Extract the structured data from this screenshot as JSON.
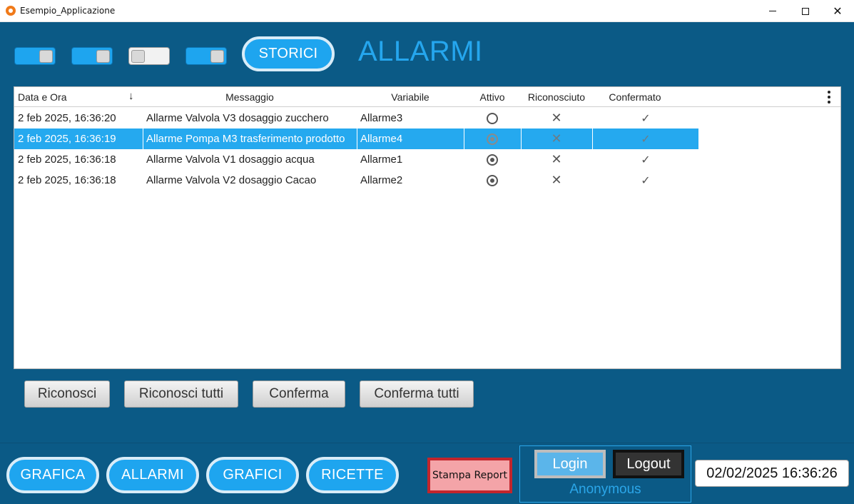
{
  "window": {
    "title": "Esempio_Applicazione",
    "minimize": "",
    "maximize": "",
    "close": "✕"
  },
  "header": {
    "storici_button": "STORICI",
    "heading": "ALLARMI",
    "toggles": [
      "on",
      "on",
      "off",
      "on"
    ]
  },
  "table": {
    "columns": [
      "Data e Ora",
      "Messaggio",
      "Variabile",
      "Attivo",
      "Riconosciuto",
      "Confermato"
    ],
    "sort_icon": "↓",
    "rows": [
      {
        "date": "2 feb 2025, 16:36:20",
        "message": "Allarme Valvola V3 dosaggio zucchero",
        "variable": "Allarme3",
        "active": false,
        "acknowledged": false,
        "confirmed": true
      },
      {
        "date": "2 feb 2025, 16:36:19",
        "message": "Allarme Pompa M3 trasferimento prodotto",
        "variable": "Allarme4",
        "active": true,
        "acknowledged": false,
        "confirmed": true
      },
      {
        "date": "2 feb 2025, 16:36:18",
        "message": "Allarme Valvola V1 dosaggio acqua",
        "variable": "Allarme1",
        "active": true,
        "acknowledged": false,
        "confirmed": true
      },
      {
        "date": "2 feb 2025, 16:36:18",
        "message": "Allarme Valvola V2 dosaggio Cacao",
        "variable": "Allarme2",
        "active": true,
        "acknowledged": false,
        "confirmed": true
      }
    ],
    "selected_row": 1,
    "x_symbol": "✕",
    "check_symbol": "✓"
  },
  "actions": {
    "riconosci": "Riconosci",
    "riconosci_tutti": "Riconosci tutti",
    "conferma": "Conferma",
    "conferma_tutti": "Conferma tutti"
  },
  "nav": {
    "grafica": "GRAFICA",
    "allarmi": "ALLARMI",
    "grafici": "GRAFICI",
    "ricette": "RICETTE"
  },
  "footer": {
    "stampa_report": "Stampa Report",
    "login": "Login",
    "logout": "Logout",
    "user": "Anonymous",
    "datetime": "02/02/2025 16:36:26"
  },
  "colors": {
    "background": "#0b5a86",
    "accent": "#1ea5ef",
    "selected_row": "#25a9ef",
    "report_button": "#f4a4a8",
    "report_border": "#c3252c"
  }
}
